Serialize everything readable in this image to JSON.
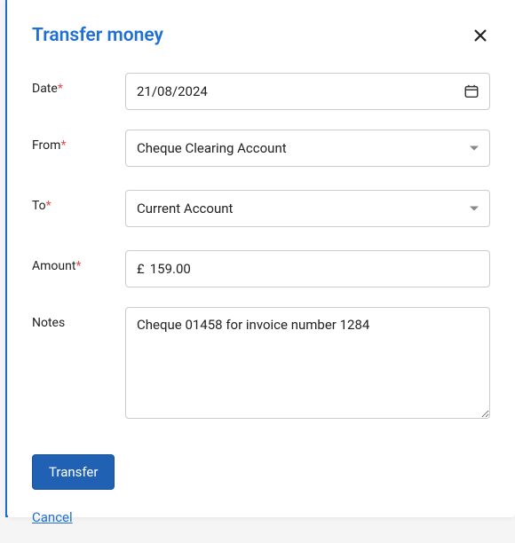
{
  "dialog": {
    "title": "Transfer money"
  },
  "fields": {
    "date": {
      "label": "Date",
      "required": "*",
      "value": "21/08/2024"
    },
    "from": {
      "label": "From",
      "required": "*",
      "value": "Cheque Clearing Account"
    },
    "to": {
      "label": "To",
      "required": "*",
      "value": "Current Account"
    },
    "amount": {
      "label": "Amount",
      "required": "*",
      "currency": "£",
      "value": "159.00"
    },
    "notes": {
      "label": "Notes",
      "value": "Cheque 01458 for invoice number 1284"
    }
  },
  "actions": {
    "submit": "Transfer",
    "cancel": "Cancel"
  }
}
